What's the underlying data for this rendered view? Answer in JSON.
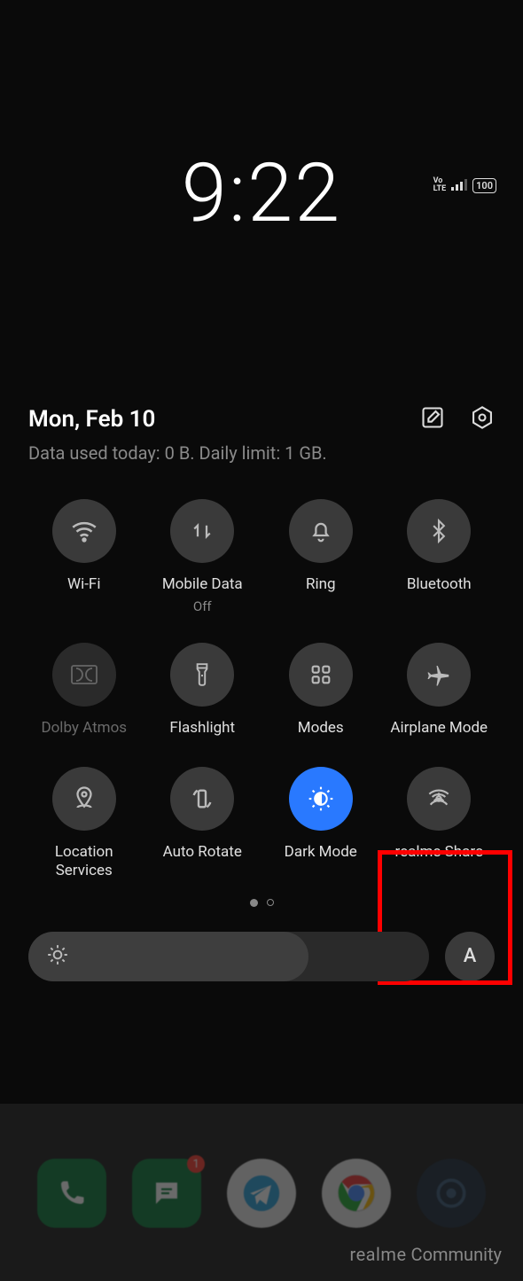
{
  "status": {
    "volte": "Vo\nLTE",
    "battery": "100"
  },
  "clock": "9:22",
  "date": "Mon, Feb 10",
  "data_usage": "Data used today: 0 B. Daily limit: 1 GB.",
  "tiles": {
    "wifi": {
      "label": "Wi-Fi"
    },
    "mobile_data": {
      "label": "Mobile Data",
      "sub": "Off"
    },
    "ring": {
      "label": "Ring"
    },
    "bluetooth": {
      "label": "Bluetooth"
    },
    "dolby": {
      "label": "Dolby Atmos"
    },
    "flashlight": {
      "label": "Flashlight"
    },
    "modes": {
      "label": "Modes"
    },
    "airplane": {
      "label": "Airplane Mode"
    },
    "location": {
      "label": "Location\nServices"
    },
    "autorotate": {
      "label": "Auto Rotate"
    },
    "darkmode": {
      "label": "Dark Mode"
    },
    "realme_share": {
      "label": "realme Share"
    }
  },
  "auto_brightness": "A",
  "watermark": {
    "brand": "realme",
    "text": "Community"
  },
  "dock_badge": "1"
}
